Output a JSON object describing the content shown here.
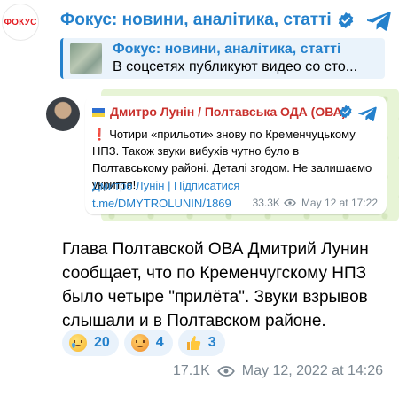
{
  "channel": {
    "avatar_text": "ФОКУС",
    "name": "Фокус: новини, аналітика, статті"
  },
  "reply": {
    "title": "Фокус: новини, аналітика, статті",
    "snippet": "В соцсетях публикуют видео со сто..."
  },
  "embed": {
    "author": "Дмитро Лунін / Полтавська ОДА (ОВА)",
    "exclamation": "❗",
    "text": "Чотири «прильоти» знову по Кременчуцькому НПЗ. Також звуки вибухів чутно було в Полтавському районі. Деталі згодом. Не залишаємо укриття!",
    "subscribe_line": "Дмитро Лунін | Підписатися",
    "link": "t.me/DMYTROLUNIN/1869",
    "views": "33.3K",
    "date": "May 12 at 17:22"
  },
  "message": {
    "text": "Глава Полтавской ОВА Дмитрий Лунин сообщает, что по Кременчугскому НПЗ было четыре \"прилёта\". Звуки взрывов слышали и в Полтавском районе."
  },
  "reactions": [
    {
      "emoji": "crying-face",
      "count": "20"
    },
    {
      "emoji": "exploding-head",
      "count": "4"
    },
    {
      "emoji": "thumbs-up",
      "count": "3"
    }
  ],
  "footer": {
    "views": "17.1K",
    "date": "May 12, 2022 at 14:26"
  },
  "colors": {
    "accent": "#2481cc",
    "embed_author": "#c9302c",
    "meta_gray": "#7b8791",
    "embed_bg": "#e7f4d6",
    "reply_bg": "#eaf3fb"
  }
}
